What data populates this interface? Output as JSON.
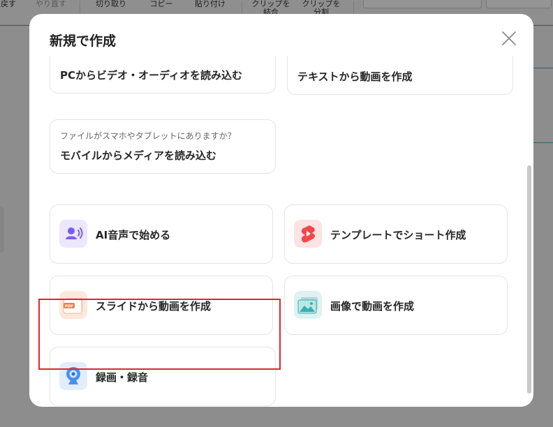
{
  "toolbar": {
    "undo": "戻す",
    "redo": "やり直す",
    "cut": "切り取り",
    "copy": "コピー",
    "paste": "貼り付け",
    "merge_clip_line1": "クリップを",
    "merge_clip_line2": "結合",
    "split_clip_line1": "クリップを",
    "split_clip_line2": "分割"
  },
  "modal": {
    "title": "新規で作成",
    "close_icon": "close-icon",
    "cards": {
      "import_pc": {
        "label": "PCからビデオ・オーディオを読み込む"
      },
      "text_to_video": {
        "label": "テキストから動画を作成"
      },
      "import_mobile": {
        "subtitle": "ファイルがスマホやタブレットにありますか？",
        "label": "モバイルからメディアを読み込む"
      },
      "ai_voice": {
        "label": "AI音声で始める",
        "icon": "ai-voice-icon"
      },
      "template_short": {
        "label": "テンプレートでショート作成",
        "icon": "shorts-play-icon"
      },
      "slides_to_video": {
        "label": "スライドから動画を作成",
        "icon": "pdf-slide-icon",
        "badge": "PDF"
      },
      "images_to_video": {
        "label": "画像で動画を作成",
        "icon": "image-icon"
      },
      "record": {
        "label": "録画・録音",
        "icon": "webcam-icon"
      }
    }
  },
  "colors": {
    "highlight": "#e0262b",
    "ai_icon_bg": "#ece7fb",
    "ai_icon": "#7b5cf0",
    "shorts_icon_bg": "#fde3e3",
    "shorts_icon": "#f2464b",
    "pdf_icon_bg": "#fde8dc",
    "pdf_icon": "#f07d4a",
    "image_icon_bg": "#dff1f1",
    "image_icon": "#3aaeb0",
    "webcam_icon_bg": "#e2edfc",
    "webcam_icon": "#4a8ff0"
  }
}
